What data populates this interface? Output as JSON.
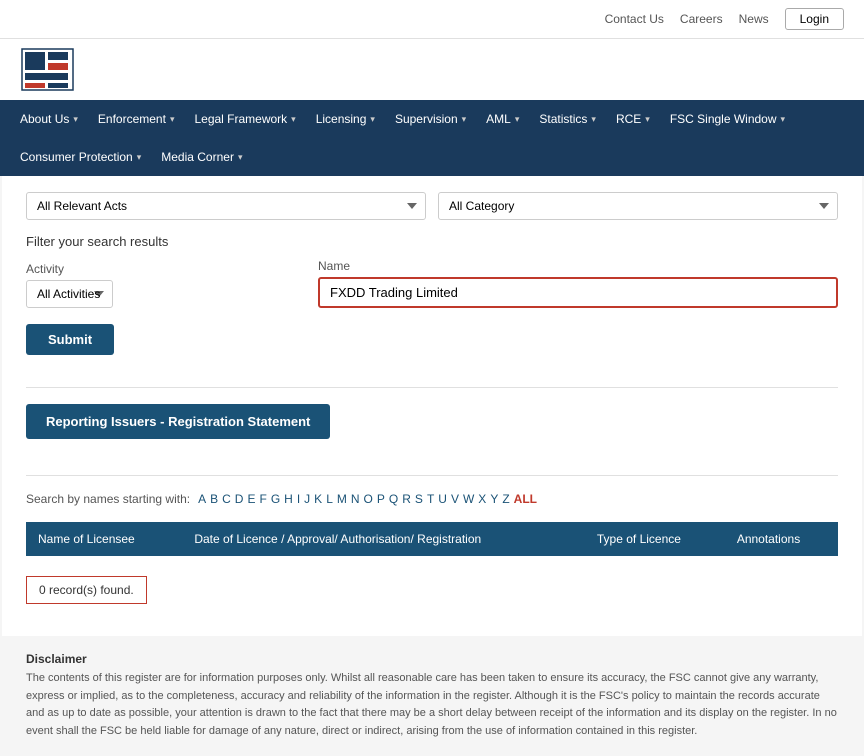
{
  "topbar": {
    "contact_us": "Contact Us",
    "careers": "Careers",
    "news": "News",
    "login": "Login"
  },
  "nav": {
    "items": [
      {
        "label": "About Us",
        "has_arrow": true
      },
      {
        "label": "Enforcement",
        "has_arrow": true
      },
      {
        "label": "Legal Framework",
        "has_arrow": true
      },
      {
        "label": "Licensing",
        "has_arrow": true
      },
      {
        "label": "Supervision",
        "has_arrow": true
      },
      {
        "label": "AML",
        "has_arrow": true
      },
      {
        "label": "Statistics",
        "has_arrow": true
      },
      {
        "label": "RCE",
        "has_arrow": true
      },
      {
        "label": "FSC Single Window",
        "has_arrow": true
      },
      {
        "label": "Consumer Protection",
        "has_arrow": true
      },
      {
        "label": "Media Corner",
        "has_arrow": true
      }
    ]
  },
  "filters": {
    "relevant_acts_label": "All Relevant Acts",
    "all_category_label": "All Category",
    "filter_title": "Filter your search results",
    "activity_label": "Activity",
    "activity_default": "All Activities",
    "name_label": "Name",
    "name_value": "FXDD Trading Limited",
    "submit_label": "Submit",
    "reg_statement_label": "Reporting Issuers - Registration Statement"
  },
  "alpha": {
    "label": "Search by names starting with:",
    "letters": [
      "A",
      "B",
      "C",
      "D",
      "E",
      "F",
      "G",
      "H",
      "I",
      "J",
      "K",
      "L",
      "M",
      "N",
      "O",
      "P",
      "Q",
      "R",
      "S",
      "T",
      "U",
      "V",
      "W",
      "X",
      "Y",
      "Z"
    ],
    "all_label": "ALL"
  },
  "table": {
    "headers": [
      "Name of Licensee",
      "Date of Licence / Approval/ Authorisation/ Registration",
      "Type of Licence",
      "Annotations"
    ],
    "no_records": "0 record(s) found."
  },
  "disclaimer": {
    "title": "Disclaimer",
    "text": "The contents of this register are for information purposes only. Whilst all reasonable care has been taken to ensure its accuracy, the FSC cannot give any warranty, express or implied, as to the completeness, accuracy and reliability of the information in the register. Although it is the FSC's policy to maintain the records accurate and as up to date as possible, your attention is drawn to the fact that there may be a short delay between receipt of the information and its display on the register. In no event shall the FSC be held liable for damage of any nature, direct or indirect, arising from the use of information contained in this register."
  }
}
